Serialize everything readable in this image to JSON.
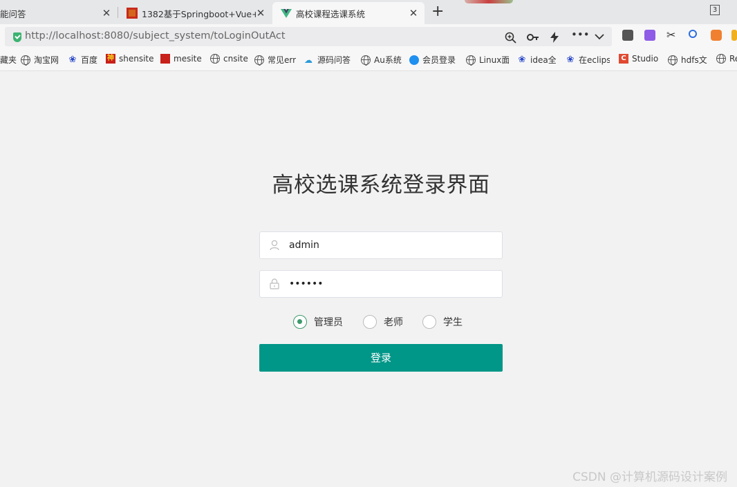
{
  "browser": {
    "tabs": [
      {
        "title": "能问答"
      },
      {
        "title": "1382基于Springboot+Vue+i"
      },
      {
        "title": "高校课程选课系统"
      }
    ],
    "tab_count": "3",
    "url_host": "http://localhost",
    "url_rest": ":8080/subject_system/toLoginOutAct"
  },
  "bookmarks": [
    {
      "label": "藏夹",
      "icon": "none"
    },
    {
      "label": "淘宝网",
      "icon": "globe-icon"
    },
    {
      "label": "百度",
      "icon": "baidu-paw-icon"
    },
    {
      "label": "shensite",
      "icon": "shen-icon"
    },
    {
      "label": "mesite",
      "icon": "red-square-icon"
    },
    {
      "label": "cnsite",
      "icon": "globe-icon"
    },
    {
      "label": "常见err",
      "icon": "globe-icon"
    },
    {
      "label": "源码问答",
      "icon": "wave-icon"
    },
    {
      "label": "Au系统",
      "icon": "globe-icon"
    },
    {
      "label": "会员登录",
      "icon": "cloud-icon"
    },
    {
      "label": "Linux面",
      "icon": "globe-icon"
    },
    {
      "label": "idea全",
      "icon": "baidu-paw-icon"
    },
    {
      "label": "在eclips",
      "icon": "baidu-paw-icon"
    },
    {
      "label": "Studio",
      "icon": "studio-icon"
    },
    {
      "label": "hdfs文",
      "icon": "globe-icon"
    },
    {
      "label": "Re",
      "icon": "globe-icon"
    }
  ],
  "login": {
    "title": "高校选课系统登录界面",
    "username_value": "admin",
    "password_value": "123456",
    "roles": [
      {
        "label": "管理员",
        "checked": true
      },
      {
        "label": "老师",
        "checked": false
      },
      {
        "label": "学生",
        "checked": false
      }
    ],
    "submit_label": "登录"
  },
  "watermark": "CSDN @计算机源码设计案例",
  "colors": {
    "accent": "#009688",
    "radio_checked": "#3c9a6c"
  }
}
